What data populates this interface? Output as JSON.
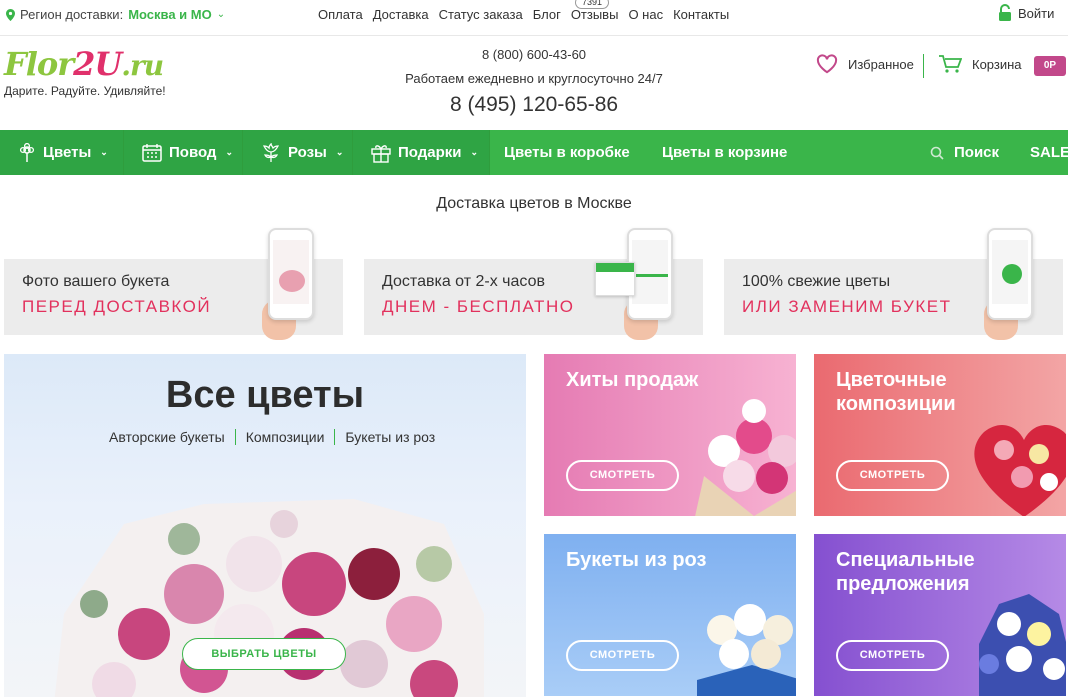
{
  "topbar": {
    "region_label": "Регион доставки:",
    "region_value": "Москва и МО",
    "links": [
      "Оплата",
      "Доставка",
      "Статус заказа",
      "Блог",
      "Отзывы",
      "О нас",
      "Контакты"
    ],
    "reviews_count": "7391",
    "login_label": "Войти"
  },
  "header": {
    "logo_part1": "Flor2U",
    "logo_part2": ".ru",
    "slogan": "Дарите. Радуйте. Удивляйте!",
    "phone_free": "8 (800) 600-43-60",
    "hours": "Работаем ежедневно и круглосуточно 24/7",
    "phone_main": "8 (495) 120-65-86",
    "favorites_label": "Избранное",
    "cart_label": "Корзина",
    "cart_total": "0Р"
  },
  "nav": {
    "items": [
      "Цветы",
      "Повод",
      "Розы",
      "Подарки",
      "Цветы в коробке",
      "Цветы в корзине"
    ],
    "search_label": "Поиск",
    "sale_label": "SALE"
  },
  "delivery": {
    "title": "Доставка цветов в Москве",
    "features": [
      {
        "line1": "Фото вашего букета",
        "line2": "ПЕРЕД ДОСТАВКОЙ"
      },
      {
        "line1": "Доставка от 2-х часов",
        "line2": "ДНЕМ - БЕСПЛАТНО"
      },
      {
        "line1": "100% свежие цветы",
        "line2": "ИЛИ ЗАМЕНИМ БУКЕТ"
      }
    ]
  },
  "catalog": {
    "main_title": "Все цветы",
    "main_links": [
      "Авторские букеты",
      "Композиции",
      "Букеты из роз"
    ],
    "main_button": "ВЫБРАТЬ ЦВЕТЫ",
    "cards": [
      {
        "title": "Хиты продаж",
        "button": "СМОТРЕТЬ"
      },
      {
        "title": "Цветочные композиции",
        "button": "СМОТРЕТЬ"
      },
      {
        "title": "Букеты из роз",
        "button": "СМОТРЕТЬ"
      },
      {
        "title": "Специальные предложения",
        "button": "СМОТРЕТЬ"
      }
    ]
  },
  "colors": {
    "brand_green": "#3ab54a",
    "accent_pink": "#e2315d",
    "cart_badge": "#c2488a"
  }
}
